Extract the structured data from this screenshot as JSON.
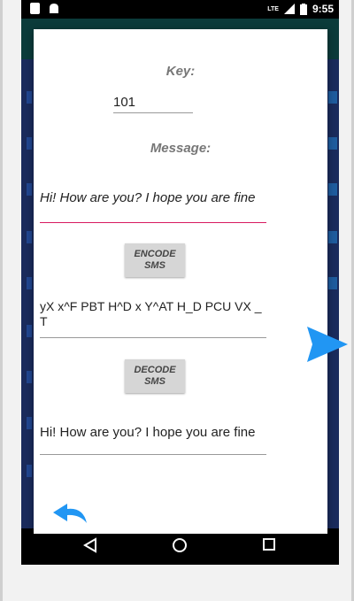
{
  "status_bar": {
    "time": "9:55",
    "network": "LTE",
    "icons": [
      "sim-icon",
      "android-icon",
      "signal-icon",
      "battery-icon"
    ]
  },
  "dialog": {
    "key_label": "Key:",
    "key_value": "101",
    "message_label": "Message:",
    "message_value": "Hi! How are you? I hope you are fine",
    "encode_button": "ENCODE\nSMS",
    "encoded_text": "yX  x^F PBT H^D  x Y^AT H_D PCU VX _T",
    "decode_button": "DECODE\nSMS",
    "decoded_text": "Hi! How are you? I hope you are fine"
  },
  "colors": {
    "accent": "#2196f3",
    "error_underline": "#d81b60",
    "app_bar": "#0b3b3a",
    "background": "#1a2b5c"
  },
  "icons": {
    "send": "send-icon",
    "undo": "undo-icon",
    "nav_back": "back-triangle-icon",
    "nav_home": "home-circle-icon",
    "nav_recents": "recents-square-icon"
  }
}
